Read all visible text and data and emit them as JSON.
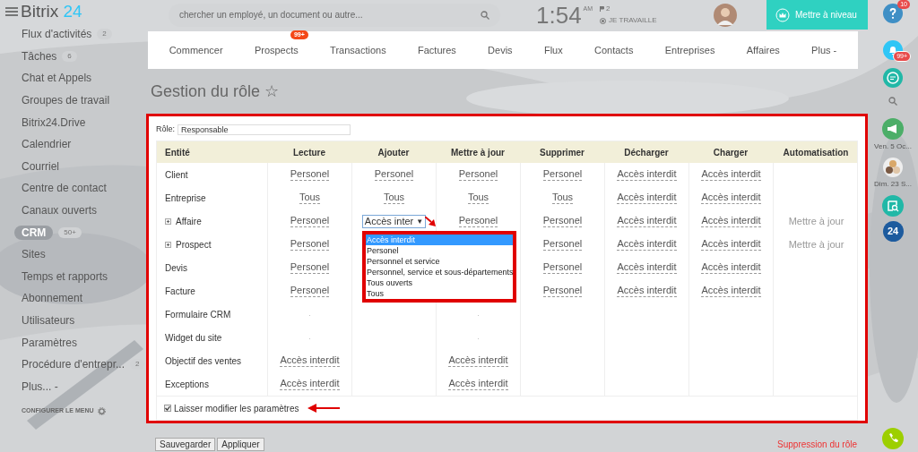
{
  "logo": {
    "name": "Bitrix",
    "accent": "24"
  },
  "search": {
    "placeholder": "chercher un employé, un document ou autre..."
  },
  "clock": {
    "time": "1:54",
    "period": "AM",
    "flag_count": "2",
    "status": "JE TRAVAILLE"
  },
  "upgrade_button": "Mettre à niveau",
  "sidebar": {
    "items": [
      {
        "label": "Flux d'activités",
        "count": "2",
        "selected": false
      },
      {
        "label": "Tâches",
        "count": "6",
        "selected": false
      },
      {
        "label": "Chat et Appels",
        "selected": false
      },
      {
        "label": "Groupes de travail",
        "selected": false
      },
      {
        "label": "Bitrix24.Drive",
        "selected": false
      },
      {
        "label": "Calendrier",
        "selected": false
      },
      {
        "label": "Courriel",
        "selected": false
      },
      {
        "label": "Centre de contact",
        "selected": false
      },
      {
        "label": "Canaux ouverts",
        "selected": false
      },
      {
        "label": "CRM",
        "count": "50+",
        "selected": true
      },
      {
        "label": "Sites",
        "selected": false
      },
      {
        "label": "Temps et rapports",
        "selected": false
      },
      {
        "label": "Abonnement",
        "selected": false
      },
      {
        "label": "Utilisateurs",
        "selected": false
      },
      {
        "label": "Paramètres",
        "selected": false
      },
      {
        "label": "Procédure d'entrepr...",
        "count": "2",
        "selected": false
      },
      {
        "label": "Plus... -",
        "selected": false
      }
    ],
    "configure": "CONFIGURER LE MENU"
  },
  "nav_tabs": [
    {
      "label": "Commencer"
    },
    {
      "label": "Prospects",
      "badge": "99+"
    },
    {
      "label": "Transactions"
    },
    {
      "label": "Factures"
    },
    {
      "label": "Devis"
    },
    {
      "label": "Flux"
    },
    {
      "label": "Contacts"
    },
    {
      "label": "Entreprises"
    },
    {
      "label": "Affaires"
    },
    {
      "label": "Plus -"
    }
  ],
  "page_title": "Gestion du rôle ☆",
  "role": {
    "label": "Rôle:",
    "value": "Responsable"
  },
  "table": {
    "columns": [
      "Entité",
      "Lecture",
      "Ajouter",
      "Mettre à jour",
      "Supprimer",
      "Décharger",
      "Charger",
      "Automatisation"
    ],
    "rows": [
      {
        "cells": [
          {
            "kind": "entity",
            "text": "Client",
            "expandable": false
          },
          {
            "kind": "link",
            "text": "Personel"
          },
          {
            "kind": "link",
            "text": "Personel"
          },
          {
            "kind": "link",
            "text": "Personel"
          },
          {
            "kind": "link",
            "text": "Personel"
          },
          {
            "kind": "link",
            "text": "Accès interdit"
          },
          {
            "kind": "link",
            "text": "Accès interdit"
          },
          null
        ]
      },
      {
        "cells": [
          {
            "kind": "entity",
            "text": "Entreprise",
            "expandable": false
          },
          {
            "kind": "link",
            "text": "Tous"
          },
          {
            "kind": "link",
            "text": "Tous"
          },
          {
            "kind": "link",
            "text": "Tous"
          },
          {
            "kind": "link",
            "text": "Tous"
          },
          {
            "kind": "link",
            "text": "Accès interdit"
          },
          {
            "kind": "link",
            "text": "Accès interdit"
          },
          null
        ]
      },
      {
        "cells": [
          {
            "kind": "entity",
            "text": "Affaire",
            "expandable": true
          },
          {
            "kind": "link",
            "text": "Personel"
          },
          {
            "kind": "select",
            "text": "Accès inter",
            "arrow": "▼"
          },
          {
            "kind": "link",
            "text": "Personel"
          },
          {
            "kind": "link",
            "text": "Personel"
          },
          {
            "kind": "link",
            "text": "Accès interdit"
          },
          {
            "kind": "link",
            "text": "Accès interdit"
          },
          {
            "kind": "text",
            "text": "Mettre à jour"
          }
        ]
      },
      {
        "cells": [
          {
            "kind": "entity",
            "text": "Prospect",
            "expandable": true
          },
          {
            "kind": "link",
            "text": "Personel"
          },
          null,
          null,
          {
            "kind": "link",
            "text": "Personel"
          },
          {
            "kind": "link",
            "text": "Accès interdit"
          },
          {
            "kind": "link",
            "text": "Accès interdit"
          },
          {
            "kind": "text",
            "text": "Mettre à jour"
          }
        ]
      },
      {
        "cells": [
          {
            "kind": "entity",
            "text": "Devis",
            "expandable": false
          },
          {
            "kind": "link",
            "text": "Personel"
          },
          null,
          null,
          {
            "kind": "link",
            "text": "Personel"
          },
          {
            "kind": "link",
            "text": "Accès interdit"
          },
          {
            "kind": "link",
            "text": "Accès interdit"
          },
          null
        ]
      },
      {
        "cells": [
          {
            "kind": "entity",
            "text": "Facture",
            "expandable": false
          },
          {
            "kind": "link",
            "text": "Personel"
          },
          null,
          null,
          {
            "kind": "link",
            "text": "Personel"
          },
          {
            "kind": "link",
            "text": "Accès interdit"
          },
          {
            "kind": "link",
            "text": "Accès interdit"
          },
          null
        ]
      },
      {
        "cells": [
          {
            "kind": "entity",
            "text": "Formulaire CRM",
            "expandable": false
          },
          {
            "kind": "dot",
            "text": "."
          },
          null,
          {
            "kind": "dot",
            "text": "."
          },
          null,
          null,
          null,
          null
        ]
      },
      {
        "cells": [
          {
            "kind": "entity",
            "text": "Widget du site",
            "expandable": false
          },
          {
            "kind": "dot",
            "text": "."
          },
          null,
          {
            "kind": "dot",
            "text": "."
          },
          null,
          null,
          null,
          null
        ]
      },
      {
        "cells": [
          {
            "kind": "entity",
            "text": "Objectif des ventes",
            "expandable": false
          },
          {
            "kind": "link",
            "text": "Accès interdit"
          },
          null,
          {
            "kind": "link",
            "text": "Accès interdit"
          },
          null,
          null,
          null,
          null
        ]
      },
      {
        "cells": [
          {
            "kind": "entity",
            "text": "Exceptions",
            "expandable": false
          },
          {
            "kind": "link",
            "text": "Accès interdit"
          },
          null,
          {
            "kind": "link",
            "text": "Accès interdit"
          },
          null,
          null,
          null,
          null
        ]
      }
    ]
  },
  "dropdown_options": [
    {
      "label": "Accès interdit",
      "selected": true
    },
    {
      "label": "Personel",
      "selected": false
    },
    {
      "label": "Personnel et service",
      "selected": false
    },
    {
      "label": "Personnel, service et sous-départements",
      "selected": false
    },
    {
      "label": "Tous ouverts",
      "selected": false
    },
    {
      "label": "Tous",
      "selected": false
    }
  ],
  "allow_edit": {
    "label": "Laisser modifier les paramètres",
    "checked": true
  },
  "buttons": [
    "Sauvegarder",
    "Appliquer"
  ],
  "delete_link": "Suppression du rôle",
  "right_bar": {
    "help_badge": "10",
    "notifications_badge": "99+",
    "dates": [
      "Ven. 5 Oc...",
      "Dim. 23 S..."
    ],
    "brand_badge": "24"
  }
}
